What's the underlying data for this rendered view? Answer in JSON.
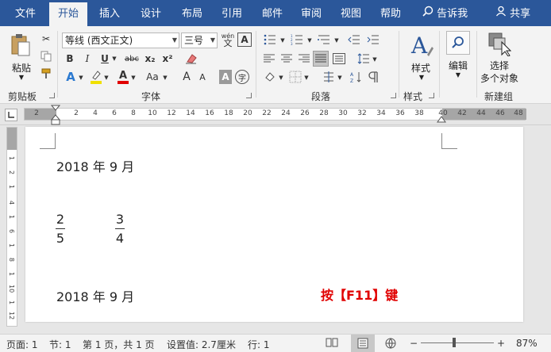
{
  "tabs": [
    "文件",
    "开始",
    "插入",
    "设计",
    "布局",
    "引用",
    "邮件",
    "审阅",
    "视图",
    "帮助"
  ],
  "tell_me": "告诉我",
  "share": "共享",
  "clipboard": {
    "paste": "粘贴",
    "group_label": "剪贴板"
  },
  "font": {
    "name": "等线 (西文正文)",
    "size": "三号",
    "group_label": "字体",
    "wen": "wén\n文",
    "bold": "B",
    "italic": "I",
    "underline": "U",
    "strike": "abc",
    "sub": "x₂",
    "sup": "x²",
    "grow": "A",
    "shrink": "A",
    "aa": "Aa",
    "char_border": "A",
    "char_shade": "A",
    "phonetic": "字"
  },
  "paragraph": {
    "group_label": "段落"
  },
  "styles": {
    "label": "样式",
    "group_label": "样式"
  },
  "editing": {
    "label": "编辑"
  },
  "select": {
    "label1": "选择",
    "label2": "多个对象",
    "group_label": "新建组"
  },
  "ruler": {
    "ticks": [
      "2",
      "2",
      "4",
      "6",
      "8",
      "10",
      "12",
      "14",
      "16",
      "18",
      "20",
      "22",
      "24",
      "26",
      "28",
      "30",
      "32",
      "34",
      "36",
      "38",
      "40",
      "42",
      "44",
      "46",
      "48"
    ],
    "vticks": [
      "1",
      "2",
      "1",
      "4",
      "1",
      "6",
      "1",
      "8",
      "1",
      "10",
      "1",
      "12",
      "1",
      "14"
    ]
  },
  "doc": {
    "date1": "2018 年 9 月",
    "frac1": {
      "num": "2",
      "den": "5"
    },
    "frac2": {
      "num": "3",
      "den": "4"
    },
    "date2": "2018 年 9 月",
    "hint": "按【F11】键"
  },
  "status": {
    "page": "页面: 1",
    "section": "节: 1",
    "pages": "第 1 页，共 1 页",
    "setting": "设置值: 2.7厘米",
    "line": "行: 1",
    "zoom": "87%"
  },
  "colors": {
    "accent": "#2b579a",
    "hint": "#e00000"
  }
}
